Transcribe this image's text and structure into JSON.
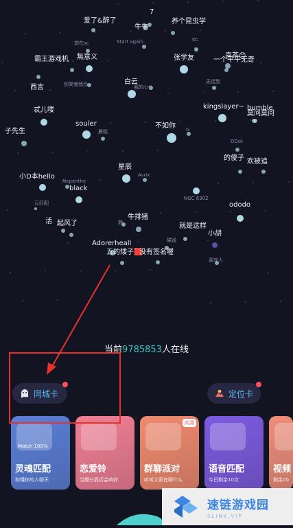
{
  "stars": [
    {
      "label": "7",
      "small": false
    },
    {
      "label": "爱了&醉了",
      "small": false
    },
    {
      "label": "牛牛",
      "small": false
    },
    {
      "label": "养个昆虫学",
      "small": false
    },
    {
      "label": "想在sc",
      "small": true
    },
    {
      "label": "Start again",
      "small": true
    },
    {
      "label": "KC",
      "small": true
    },
    {
      "label": "霸王游戏机",
      "small": false
    },
    {
      "label": "無意义",
      "small": false
    },
    {
      "label": "张学友",
      "small": false
    },
    {
      "label": "喜茶😊",
      "small": false
    },
    {
      "label": "一个平平无奇",
      "small": false
    },
    {
      "label": "西言",
      "small": false
    },
    {
      "label": "别笑我我😊",
      "small": true
    },
    {
      "label": "白云",
      "small": false
    },
    {
      "label": "我的心❤",
      "small": true
    },
    {
      "label": "无话到",
      "small": true
    },
    {
      "label": "忒儿喽",
      "small": false
    },
    {
      "label": "kingslayer~",
      "small": false
    },
    {
      "label": "bumble",
      "small": false
    },
    {
      "label": "莫问莫问",
      "small": false
    },
    {
      "label": "子先生",
      "small": false
    },
    {
      "label": "souler",
      "small": false
    },
    {
      "label": "晨晓",
      "small": true
    },
    {
      "label": "不如你",
      "small": false
    },
    {
      "label": "G",
      "small": true
    },
    {
      "label": "DDot",
      "small": true
    },
    {
      "label": "的傻子",
      "small": false
    },
    {
      "label": "欢被追",
      "small": false
    },
    {
      "label": "星辰",
      "small": false
    },
    {
      "label": "小D本hello",
      "small": false
    },
    {
      "label": "Nepenthe",
      "small": true
    },
    {
      "label": "Avrix",
      "small": true
    },
    {
      "label": "black",
      "small": false
    },
    {
      "label": "NGC 6302",
      "small": true
    },
    {
      "label": "ododo",
      "small": false
    },
    {
      "label": "云匹配",
      "small": true
    },
    {
      "label": "活",
      "small": false
    },
    {
      "label": "起风了",
      "small": false
    },
    {
      "label": "静",
      "small": true
    },
    {
      "label": "牛排猪",
      "small": false
    },
    {
      "label": "就是这样",
      "small": false
    },
    {
      "label": "小胡",
      "small": false
    },
    {
      "label": "猫浅",
      "small": true
    },
    {
      "label": "Adorerheall",
      "small": false
    },
    {
      "label": "五的矮子🟥",
      "small": false
    },
    {
      "label": "没有签名喔",
      "small": false
    },
    {
      "label": "喜欢人",
      "small": true
    }
  ],
  "online": {
    "prefix": "当前",
    "count": "9785853",
    "suffix": "人在线"
  },
  "chips": {
    "city_label": "同城卡",
    "locate_label": "定位卡"
  },
  "cards": [
    {
      "title": "灵魂匹配",
      "sub": "和懂你的人聊天",
      "art": "Match 100%",
      "badge": "",
      "color": "#5b7fd6"
    },
    {
      "title": "恋爱铃",
      "sub": "当爆分靠近会响铃",
      "art": "",
      "badge": "",
      "color": "#f07f93"
    },
    {
      "title": "群聊派对",
      "sub": "听听大家在聊什么",
      "art": "",
      "badge": "内测",
      "color": "#f08a6e"
    },
    {
      "title": "语音匹配",
      "sub": "今日剩余10次",
      "art": "",
      "badge": "",
      "color": "#7e5be0"
    },
    {
      "title": "视频",
      "sub": "剩余20",
      "art": "",
      "badge": "",
      "color": "#f08e7a"
    }
  ],
  "watermark": {
    "name": "速链游戏园",
    "sub": "SLINK.VIP"
  },
  "colors": {
    "background": "#131422",
    "accent": "#35c7c1",
    "annotation": "#e8302c"
  }
}
